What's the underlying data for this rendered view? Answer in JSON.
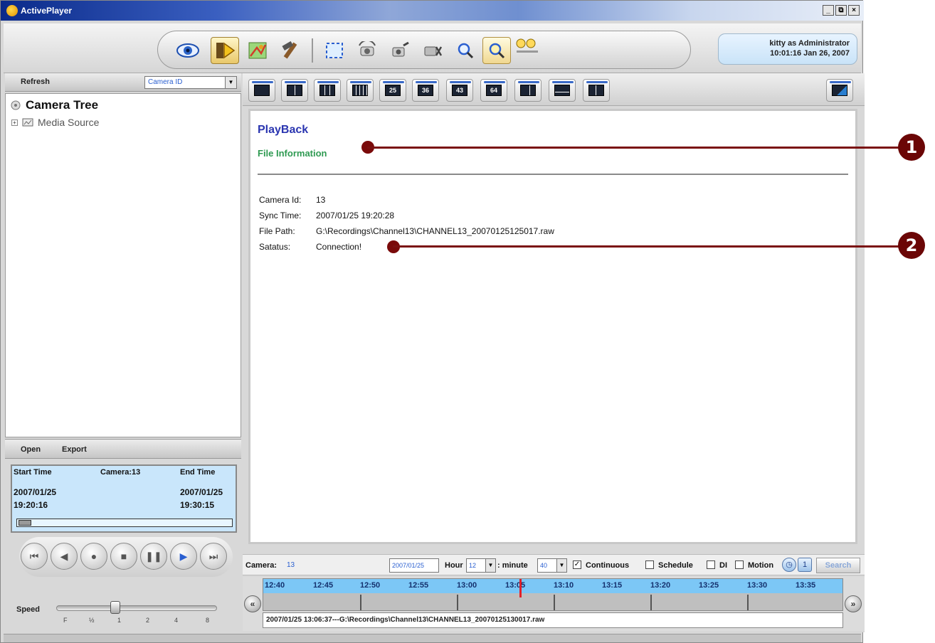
{
  "window": {
    "title": "ActivePlayer",
    "controls": [
      "_",
      "⧉",
      "×"
    ]
  },
  "toolbar": {
    "buttons": [
      "eye-icon",
      "playback-icon",
      "map-icon",
      "tools-icon",
      "fullscreen-icon",
      "camera-rotate-icon",
      "snapshot-icon",
      "record-icon",
      "zoom-in-icon",
      "zoom-out-icon",
      "audio-icon"
    ]
  },
  "user": {
    "line1": "kitty as Administrator",
    "line2": "10:01:16 Jan 26, 2007"
  },
  "left": {
    "refresh_label": "Refresh",
    "camera_select": "Camera ID",
    "tree_root": "Camera Tree",
    "tree_child": "Media Source",
    "open_label": "Open",
    "export_label": "Export",
    "timeinfo": {
      "start_label": "Start Time",
      "camera_label": "Camera:13",
      "end_label": "End Time",
      "start_date": "2007/01/25",
      "start_time": "19:20:16",
      "end_date": "2007/01/25",
      "end_time": "19:30:15"
    },
    "speed_label": "Speed",
    "speed_ticks": [
      "F",
      "½",
      "1",
      "2",
      "4",
      "8"
    ]
  },
  "layouts": [
    "1",
    "4",
    "9",
    "16",
    "25",
    "36",
    "43",
    "64",
    "L1",
    "L2",
    "L3"
  ],
  "layout_labels": {
    "25": "25",
    "36": "36",
    "43": "43",
    "64": "64"
  },
  "content": {
    "playback_title": "PlayBack",
    "file_info_title": "File Information",
    "camera_id_label": "Camera Id:",
    "camera_id_value": "13",
    "sync_time_label": "Sync Time:",
    "sync_time_value": "2007/01/25 19:20:28",
    "file_path_label": "File Path:",
    "file_path_value": "G:\\Recordings\\Channel13\\CHANNEL13_20070125125017.raw",
    "status_label": "Satatus:",
    "status_value": "Connection!"
  },
  "search": {
    "camera_label": "Camera:",
    "camera_value": "13",
    "date_value": "2007/01/25",
    "hour_label": "Hour",
    "hour_value": "12",
    "minute_label": ": minute",
    "minute_value": "40",
    "continuous_label": "Continuous",
    "schedule_label": "Schedule",
    "di_label": "DI",
    "motion_label": "Motion",
    "search_label": "Search"
  },
  "timeline": {
    "ticks": [
      "12:40",
      "12:45",
      "12:50",
      "12:55",
      "13:00",
      "13:05",
      "13:10",
      "13:15",
      "13:20",
      "13:25",
      "13:30",
      "13:35"
    ],
    "file_entry": "2007/01/25 13:06:37---G:\\Recordings\\Channel13\\CHANNEL13_20070125130017.raw"
  },
  "callouts": [
    "1",
    "2"
  ]
}
